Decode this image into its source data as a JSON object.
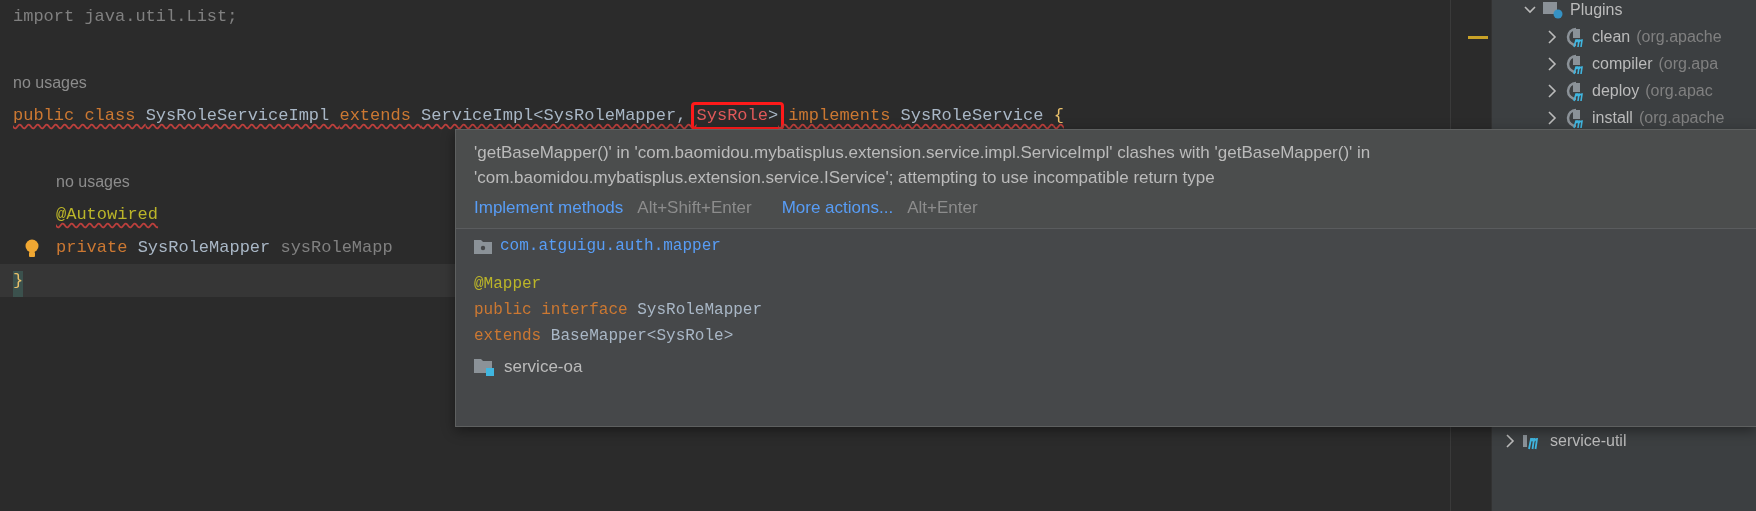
{
  "editor": {
    "lines": [
      {
        "kind": "code",
        "tokens": [
          {
            "kind": "muted",
            "text": "import java.util.List;"
          }
        ]
      },
      {
        "kind": "blank"
      },
      {
        "kind": "hint",
        "text": "no usages"
      },
      {
        "kind": "code",
        "squiggly": true,
        "tokens": [
          {
            "kind": "keyword",
            "text": "public class "
          },
          {
            "kind": "plain",
            "text": "SysRoleServiceImpl "
          },
          {
            "kind": "keyword",
            "text": "extends "
          },
          {
            "kind": "plain",
            "text": "ServiceImpl<SysRoleMapper, "
          },
          {
            "kind": "group",
            "boxed": true,
            "tokens": [
              {
                "kind": "error",
                "text": "SysRole"
              },
              {
                "kind": "plain",
                "text": ">"
              }
            ]
          },
          {
            "kind": "keyword",
            "text": " implements "
          },
          {
            "kind": "plain",
            "text": "SysRoleService "
          },
          {
            "kind": "brace",
            "text": "{"
          }
        ],
        "children": [
          {
            "kind": "blank"
          },
          {
            "kind": "hint",
            "text": "no usages"
          },
          {
            "kind": "code",
            "squiggly": true,
            "tokens": [
              {
                "kind": "annotation",
                "text": "@Autowired"
              }
            ]
          },
          {
            "kind": "code",
            "lightbulb": true,
            "tokens": [
              {
                "kind": "keyword",
                "text": "private "
              },
              {
                "kind": "plain",
                "text": "SysRoleMapper "
              },
              {
                "kind": "muted",
                "text": "sysRoleMapp"
              }
            ]
          }
        ]
      },
      {
        "kind": "code",
        "current": true,
        "tokens": [
          {
            "kind": "brace",
            "text": "}"
          }
        ]
      }
    ]
  },
  "popup": {
    "message": "'getBaseMapper()' in 'com.baomidou.mybatisplus.extension.service.impl.ServiceImpl' clashes with 'getBaseMapper()' in 'com.baomidou.mybatisplus.extension.service.IService'; attempting to use incompatible return type",
    "actions": [
      {
        "label": "Implement methods",
        "shortcut": "Alt+Shift+Enter"
      },
      {
        "label": "More actions...",
        "shortcut": "Alt+Enter"
      }
    ],
    "package": "com.atguigu.auth.mapper",
    "declaration": [
      [
        {
          "kind": "annotation",
          "text": "@Mapper"
        }
      ],
      [
        {
          "kind": "keyword",
          "text": "public interface "
        },
        {
          "kind": "plain",
          "text": "SysRoleMapper"
        }
      ],
      [
        {
          "kind": "keyword",
          "text": "extends "
        },
        {
          "kind": "plain",
          "text": "BaseMapper<SysRole>"
        }
      ]
    ],
    "module": "service-oa"
  },
  "maven_panel": {
    "items": [
      {
        "label": "Plugins",
        "kind": "folder",
        "expanded": true,
        "children": [
          {
            "label": "clean",
            "detail": "(org.apache",
            "kind": "plugin",
            "expanded": false
          },
          {
            "label": "compiler",
            "detail": "(org.apa",
            "kind": "plugin",
            "expanded": false
          },
          {
            "label": "deploy",
            "detail": "(org.apac",
            "kind": "plugin",
            "expanded": false
          },
          {
            "label": "install",
            "detail": "(org.apache",
            "kind": "plugin",
            "expanded": false
          }
        ]
      },
      {
        "label": "service-util",
        "kind": "module",
        "expanded": false
      }
    ]
  }
}
